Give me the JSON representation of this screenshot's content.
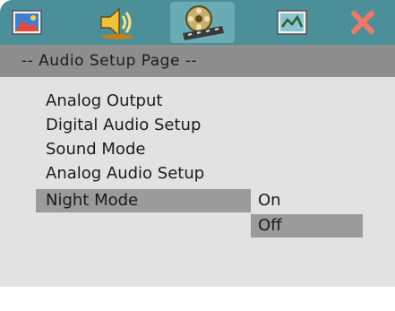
{
  "title": "-- Audio Setup Page --",
  "tabs": [
    {
      "icon": "picture-icon"
    },
    {
      "icon": "speaker-icon"
    },
    {
      "icon": "film-reel-icon",
      "active": true
    },
    {
      "icon": "preferences-icon"
    },
    {
      "icon": "close-x-icon"
    }
  ],
  "menu": {
    "items": [
      "Analog Output",
      "Digital Audio Setup",
      "Sound Mode",
      "Analog Audio Setup",
      "Night Mode"
    ],
    "selected_index": 4
  },
  "options": {
    "items": [
      "On",
      "Off"
    ],
    "selected_index": 1
  },
  "colors": {
    "icon_bar": "#4b8f98",
    "title_bar": "#8e8e8e",
    "panel": "#e2e2e2",
    "highlight": "#9b9b9b",
    "close_x": "#f07866"
  }
}
